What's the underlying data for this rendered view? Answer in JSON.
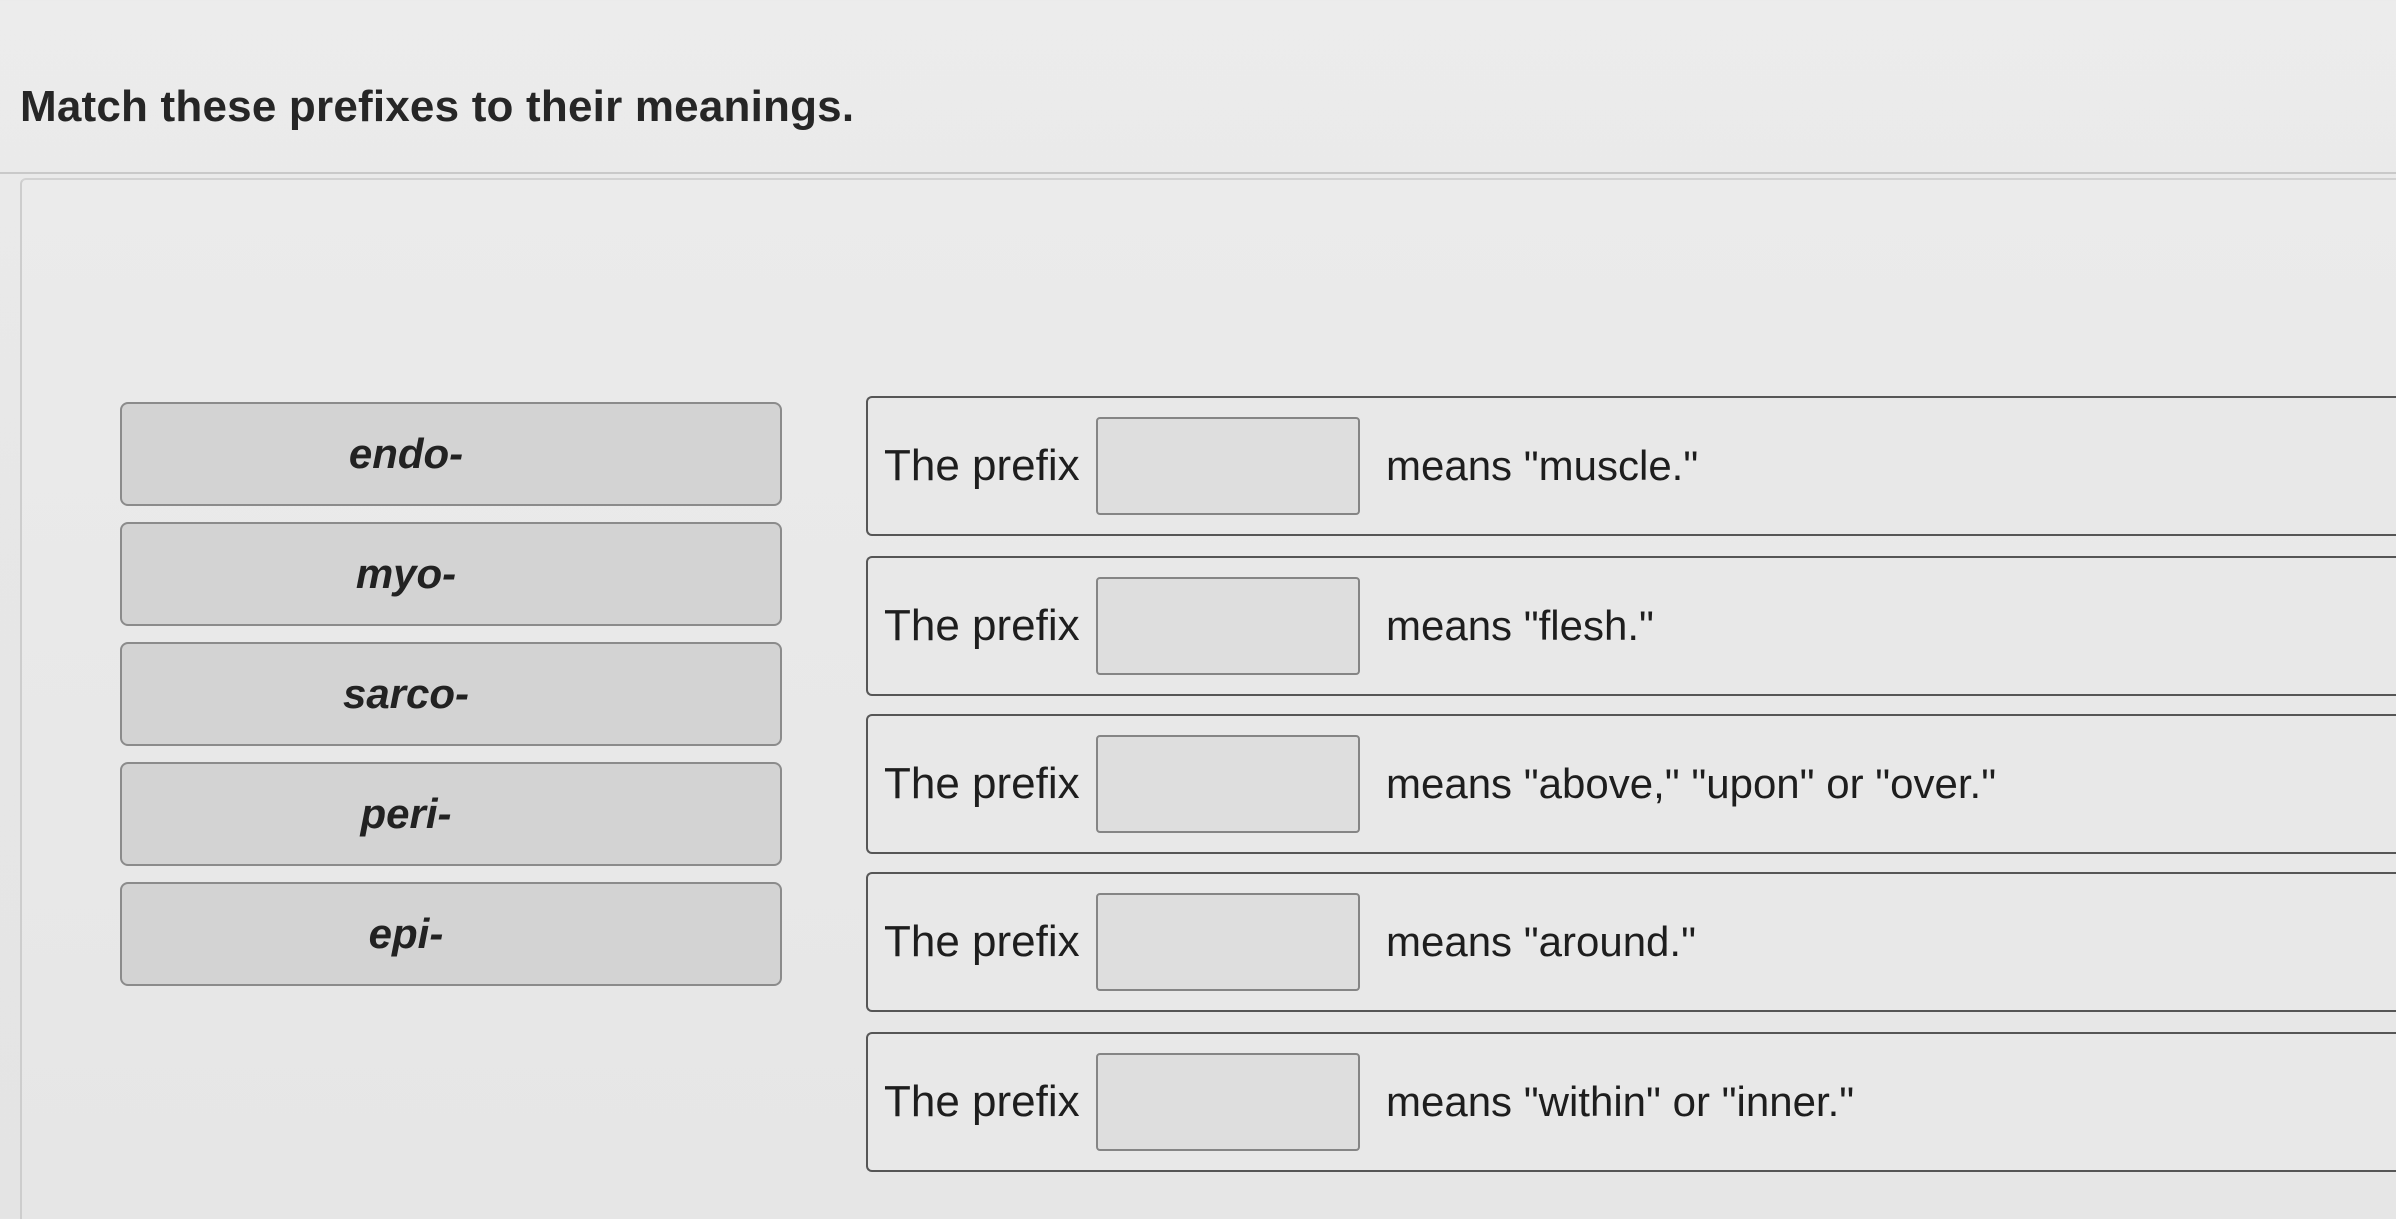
{
  "question": {
    "title": "Match these prefixes to their meanings."
  },
  "chips": [
    {
      "label": "endo-"
    },
    {
      "label": "myo-"
    },
    {
      "label": "sarco-"
    },
    {
      "label": "peri-"
    },
    {
      "label": "epi-"
    }
  ],
  "sentences": [
    {
      "lead": "The prefix",
      "meaning": "means \"muscle.\""
    },
    {
      "lead": "The prefix",
      "meaning": "means \"flesh.\""
    },
    {
      "lead": "The prefix",
      "meaning": "means \"above,\" \"upon\" or \"over.\""
    },
    {
      "lead": "The prefix",
      "meaning": "means \"around.\""
    },
    {
      "lead": "The prefix",
      "meaning": "means \"within\" or \"inner.\""
    }
  ]
}
